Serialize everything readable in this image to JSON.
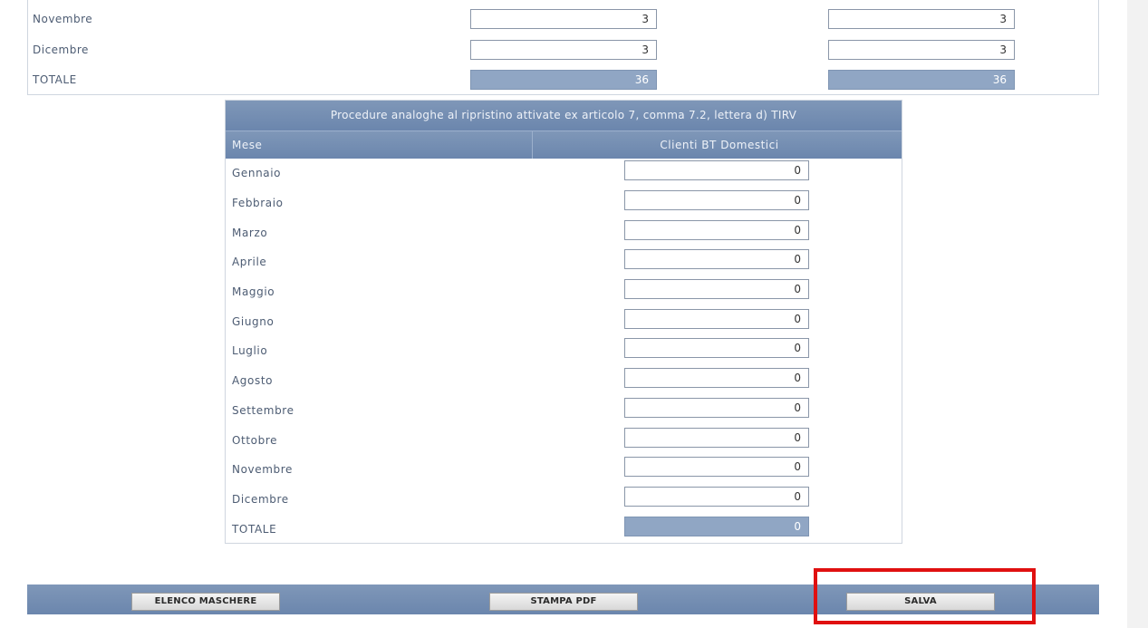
{
  "top_table": {
    "rows": [
      {
        "label": "Novembre",
        "col1": "3",
        "col2": "3"
      },
      {
        "label": "Dicembre",
        "col1": "3",
        "col2": "3"
      }
    ],
    "total": {
      "label": "TOTALE",
      "col1": "36",
      "col2": "36"
    }
  },
  "procedure_table": {
    "title": "Procedure analoghe al ripristino attivate ex articolo 7, comma 7.2, lettera d) TIRV",
    "header_month": "Mese",
    "header_clients": "Clienti BT Domestici",
    "rows": [
      {
        "label": "Gennaio",
        "value": "0"
      },
      {
        "label": "Febbraio",
        "value": "0"
      },
      {
        "label": "Marzo",
        "value": "0"
      },
      {
        "label": "Aprile",
        "value": "0"
      },
      {
        "label": "Maggio",
        "value": "0"
      },
      {
        "label": "Giugno",
        "value": "0"
      },
      {
        "label": "Luglio",
        "value": "0"
      },
      {
        "label": "Agosto",
        "value": "0"
      },
      {
        "label": "Settembre",
        "value": "0"
      },
      {
        "label": "Ottobre",
        "value": "0"
      },
      {
        "label": "Novembre",
        "value": "0"
      },
      {
        "label": "Dicembre",
        "value": "0"
      }
    ],
    "total": {
      "label": "TOTALE",
      "value": "0"
    }
  },
  "toolbar": {
    "elenco_label": "ELENCO MASCHERE",
    "stampa_label": "STAMPA PDF",
    "salva_label": "SALVA"
  },
  "colors": {
    "header_blue": "#6b86ad",
    "total_cell": "#90a6c4",
    "highlight_red": "#e01010"
  }
}
